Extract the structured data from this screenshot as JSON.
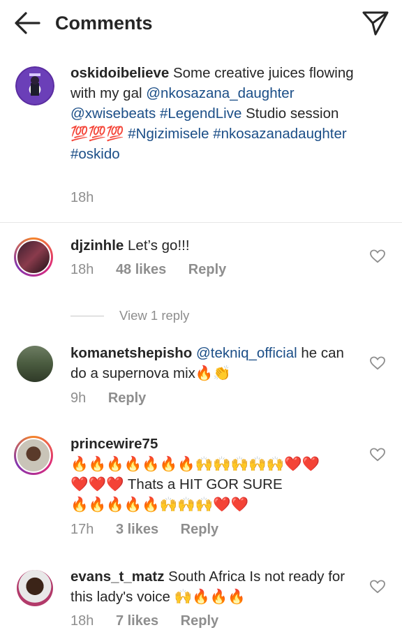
{
  "header": {
    "title": "Comments"
  },
  "caption": {
    "username": "oskidoibelieve",
    "text": "Some creative juices flowing with my gal",
    "mentions": [
      "@nkosazana_daughter",
      "@xwisebeats"
    ],
    "hashtag1": "#LegendLive",
    "text2": "Studio session",
    "emoji": "💯💯💯",
    "hashtags": [
      "#Ngizimisele",
      "#nkosazanadaughter",
      "#oskido"
    ],
    "time": "18h"
  },
  "comments": [
    {
      "username": "djzinhle",
      "text": "Let’s go!!!",
      "time": "18h",
      "likes": "48 likes",
      "reply": "Reply"
    },
    {
      "username": "komanetshepisho",
      "mention": "@tekniq_official",
      "text": "he can do a supernova mix",
      "emoji": "🔥👏",
      "time": "9h",
      "reply": "Reply"
    },
    {
      "username": "princewire75",
      "line1": "🔥🔥🔥🔥🔥🔥🔥🙌🙌🙌🙌🙌❤️❤️",
      "line2_emoji": "❤️❤️❤️",
      "line2_text": "Thats a HIT GOR SURE",
      "line3": "🔥🔥🔥🔥🔥🙌🙌🙌❤️❤️",
      "time": "17h",
      "likes": "3 likes",
      "reply": "Reply"
    },
    {
      "username": "evans_t_matz",
      "text": "South Africa Is not ready for this lady's voice",
      "emoji": "🙌🔥🔥🔥",
      "time": "18h",
      "likes": "7 likes",
      "reply": "Reply"
    }
  ],
  "view_replies": "View 1 reply",
  "icons": {
    "back": "arrow-left-icon",
    "send": "send-icon",
    "like": "heart-outline-icon"
  }
}
